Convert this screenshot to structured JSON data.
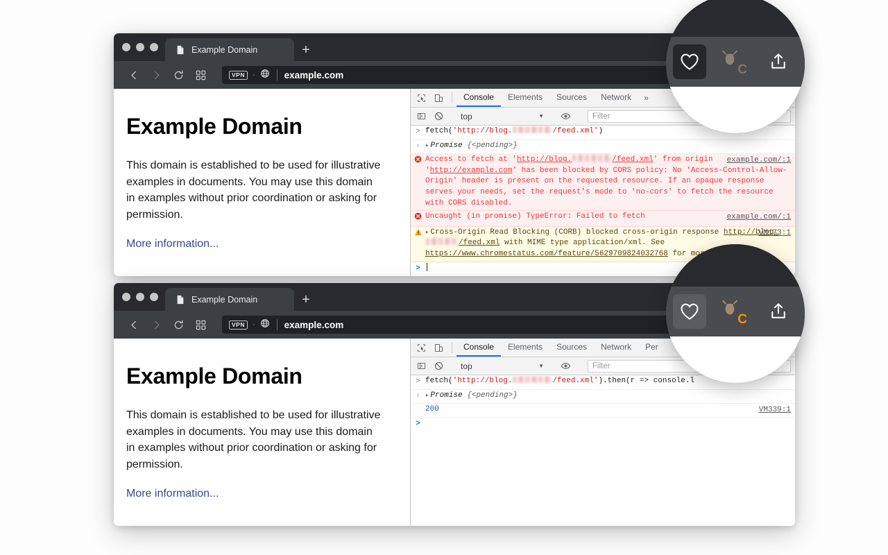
{
  "app": {
    "browser_name": "Chrome",
    "accent_blue": "#1a73e8",
    "error_red": "#e63946",
    "warn_yellow": "#fffbe5",
    "tabstrip_bg": "#292a2d",
    "navbar_bg": "#3c4043"
  },
  "window1": {
    "tab": {
      "title": "Example Domain",
      "favicon": "document-icon"
    },
    "newtab_label": "+",
    "nav": {
      "back": "‹",
      "forward": "›",
      "reload": "reload-icon",
      "apps": "grid-icon"
    },
    "omnibox": {
      "vpn_badge": "VPN",
      "separator": "·",
      "globe": "globe-icon",
      "url": "example.com"
    },
    "page": {
      "heading": "Example Domain",
      "paragraph": "This domain is established to be used for illustrative examples in documents. You may use this domain in examples without prior coordination or asking for permission.",
      "link": "More information..."
    },
    "devtools": {
      "inspect_icon": "inspect-element-icon",
      "device_icon": "device-toolbar-icon",
      "tabs": [
        {
          "label": "Console",
          "active": true
        },
        {
          "label": "Elements",
          "active": false
        },
        {
          "label": "Sources",
          "active": false
        },
        {
          "label": "Network",
          "active": false
        }
      ],
      "more_tabs": "»",
      "toolbar": {
        "sidebar_icon": "console-sidebar-icon",
        "clear_icon": "clear-console-icon",
        "context": "top",
        "context_caret": "▼",
        "eye_icon": "live-expression-icon",
        "filter_placeholder": "Filter"
      },
      "entries": [
        {
          "kind": "input",
          "gutter": ">",
          "code_prefix": "fetch(",
          "str_open": "'http://blog.",
          "redacted": true,
          "str_close": "/feed.xml'",
          "code_suffix": ")"
        },
        {
          "kind": "result",
          "gutter": "‹",
          "expander": "▸",
          "text": "Promise",
          "detail": "{<pending>}"
        },
        {
          "kind": "error",
          "gutter": "error-icon",
          "text_a": "Access to fetch at '",
          "link_a": "http://blog.",
          "redacted": true,
          "link_b": "/feed.xml",
          "text_b": "' from origin '",
          "link_c": "http://example.com",
          "text_c": "' has been blocked by CORS policy: No 'Access-Control-Allow-Origin' header is present on the requested resource. If an opaque response serves your needs, set the request's mode to 'no-cors' to fetch the resource with CORS disabled.",
          "source": "example.com/:1"
        },
        {
          "kind": "error",
          "gutter": "error-icon",
          "text_a": "Uncaught (in promise) TypeError: Failed to fetch",
          "source": "example.com/:1"
        },
        {
          "kind": "warn",
          "gutter": "warning-icon",
          "expander": "▸",
          "text_a": "Cross-Origin Read Blocking (CORB) blocked cross-origin response ",
          "link_a": "http://blog.",
          "redacted": true,
          "link_b": "/feed.xml",
          "text_b": " with MIME type application/xml. See ",
          "link_c": "https://www.chromestatus.com/feature/5629709824032768",
          "text_c": " for more details.",
          "source": "VM173:1"
        },
        {
          "kind": "prompt",
          "gutter": ">",
          "cursor": true
        }
      ]
    }
  },
  "window2": {
    "tab": {
      "title": "Example Domain",
      "favicon": "document-icon"
    },
    "newtab_label": "+",
    "nav": {
      "back": "‹",
      "forward": "›",
      "reload": "reload-icon",
      "apps": "grid-icon"
    },
    "omnibox": {
      "vpn_badge": "VPN",
      "separator": "·",
      "globe": "globe-icon",
      "url": "example.com"
    },
    "page": {
      "heading": "Example Domain",
      "paragraph": "This domain is established to be used for illustrative examples in documents. You may use this domain in examples without prior coordination or asking for permission.",
      "link": "More information..."
    },
    "devtools": {
      "inspect_icon": "inspect-element-icon",
      "device_icon": "device-toolbar-icon",
      "tabs": [
        {
          "label": "Console",
          "active": true
        },
        {
          "label": "Elements",
          "active": false
        },
        {
          "label": "Sources",
          "active": false
        },
        {
          "label": "Network",
          "active": false
        },
        {
          "label": "Per",
          "active": false
        }
      ],
      "toolbar": {
        "sidebar_icon": "console-sidebar-icon",
        "clear_icon": "clear-console-icon",
        "context": "top",
        "context_caret": "▼",
        "eye_icon": "live-expression-icon",
        "filter_placeholder": "Filter"
      },
      "entries": [
        {
          "kind": "input",
          "gutter": ">",
          "code_prefix": "fetch(",
          "str_open": "'http://blog.",
          "redacted": true,
          "str_close": "/feed.xml'",
          "code_suffix": ").then(r => console.l"
        },
        {
          "kind": "result",
          "gutter": "‹",
          "expander": "▸",
          "text": "Promise",
          "detail": "{<pending>}"
        },
        {
          "kind": "log",
          "gutter": "",
          "value": "200",
          "source": "VM339:1"
        },
        {
          "kind": "prompt",
          "gutter": ">",
          "cursor": false
        }
      ]
    }
  },
  "magnifier1": {
    "label": "magnified-toolbar-inactive",
    "buttons": [
      {
        "name": "favorite-heart-icon",
        "state": "boxed-dark"
      },
      {
        "name": "bug-extension-icon",
        "state": "inactive",
        "letter": "C",
        "letter_color": "#7d7568"
      },
      {
        "name": "share-upload-icon",
        "state": "plain"
      }
    ]
  },
  "magnifier2": {
    "label": "magnified-toolbar-active",
    "buttons": [
      {
        "name": "favorite-heart-icon",
        "state": "boxed-light"
      },
      {
        "name": "bug-extension-icon",
        "state": "active",
        "letter": "C",
        "letter_color": "#f29100"
      },
      {
        "name": "share-upload-icon",
        "state": "plain"
      }
    ]
  }
}
